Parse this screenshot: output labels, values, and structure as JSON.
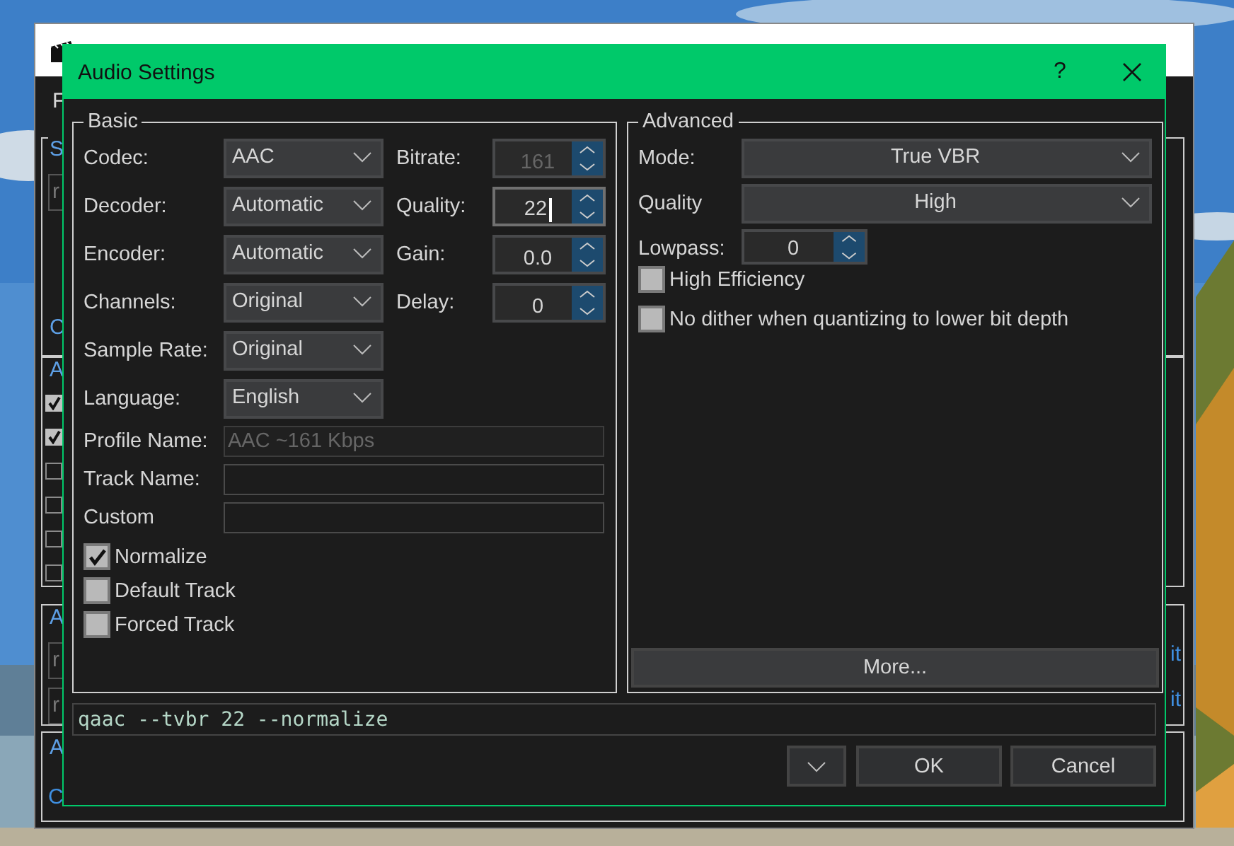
{
  "parent_window": {
    "menu_fragment": "F",
    "fragments": [
      {
        "text": "S",
        "kind": "group"
      },
      {
        "text": "r",
        "kind": "field"
      },
      {
        "text": "C",
        "kind": "group"
      },
      {
        "text": "A",
        "kind": "group"
      },
      {
        "text": "A",
        "kind": "group"
      },
      {
        "text": "r",
        "kind": "field"
      },
      {
        "text": "r",
        "kind": "field"
      },
      {
        "text": "A",
        "kind": "group"
      },
      {
        "text": "C",
        "kind": "link"
      },
      {
        "text": "it",
        "kind": "link"
      },
      {
        "text": "it",
        "kind": "link"
      }
    ],
    "list_checks": [
      {
        "checked": true
      },
      {
        "checked": true
      },
      {
        "checked": false
      },
      {
        "checked": false
      },
      {
        "checked": false
      },
      {
        "checked": false
      }
    ]
  },
  "dialog": {
    "title": "Audio Settings",
    "help": "?",
    "basic": {
      "title": "Basic",
      "rows": [
        {
          "label": "Codec:",
          "value": "AAC",
          "spin": {
            "label": "Bitrate:",
            "value": "161",
            "disabled": true,
            "focused": false
          }
        },
        {
          "label": "Decoder:",
          "value": "Automatic",
          "spin": {
            "label": "Quality:",
            "value": "22",
            "disabled": false,
            "focused": true
          }
        },
        {
          "label": "Encoder:",
          "value": "Automatic",
          "spin": {
            "label": "Gain:",
            "value": "0.0",
            "disabled": false,
            "focused": false
          }
        },
        {
          "label": "Channels:",
          "value": "Original",
          "spin": {
            "label": "Delay:",
            "value": "0",
            "disabled": false,
            "focused": false
          }
        },
        {
          "label": "Sample Rate:",
          "value": "Original"
        },
        {
          "label": "Language:",
          "value": "English"
        }
      ],
      "fields": [
        {
          "label": "Profile Name:",
          "value": "AAC ~161 Kbps",
          "disabled": true
        },
        {
          "label": "Track Name:"
        },
        {
          "label": "Custom"
        }
      ],
      "checkboxes": [
        {
          "label": "Normalize",
          "checked": true
        },
        {
          "label": "Default Track",
          "checked": false
        },
        {
          "label": "Forced Track",
          "checked": false
        }
      ]
    },
    "advanced": {
      "title": "Advanced",
      "combos": [
        {
          "label": "Mode:",
          "value": "True VBR"
        },
        {
          "label": "Quality",
          "value": "High"
        }
      ],
      "lowpass": {
        "label": "Lowpass:",
        "value": "0"
      },
      "checkboxes": [
        {
          "label": "High Efficiency",
          "checked": false
        },
        {
          "label": "No dither when quantizing to lower bit depth",
          "checked": false
        }
      ],
      "more_button": "More..."
    },
    "command": "qaac --tvbr 22 --normalize",
    "buttons": [
      {
        "kind": "menu"
      },
      {
        "kind": "text",
        "label": "OK"
      },
      {
        "kind": "text",
        "label": "Cancel"
      }
    ]
  }
}
